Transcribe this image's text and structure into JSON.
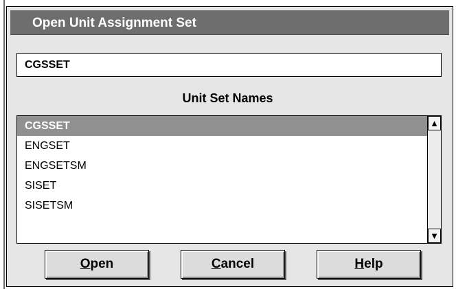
{
  "dialog": {
    "title": "Open Unit Assignment Set",
    "name_field_value": "CGSSET",
    "list_label": "Unit Set Names",
    "list_items": [
      "CGSSET",
      "ENGSET",
      "ENGSETSM",
      "SISET",
      "SISETSM"
    ],
    "selected_index": 0
  },
  "buttons": {
    "open": {
      "mnemonic": "O",
      "rest": "pen"
    },
    "cancel": {
      "mnemonic": "C",
      "rest": "ancel"
    },
    "help": {
      "mnemonic": "H",
      "rest": "elp"
    }
  },
  "icons": {
    "scroll_up": "caret-up-icon",
    "scroll_down": "caret-down-icon"
  },
  "colors": {
    "title_bar": "#6e6e6e",
    "selection": "#909090",
    "dialog_bg": "#e6e6e6"
  }
}
